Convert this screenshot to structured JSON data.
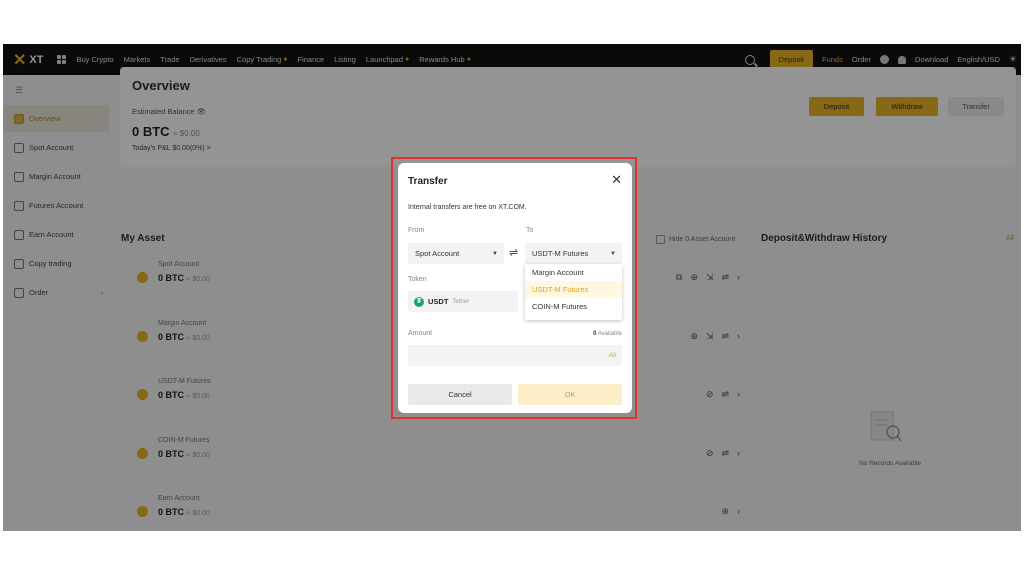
{
  "topbar": {
    "logo": "XT",
    "nav": [
      {
        "label": "Buy Crypto",
        "fire": false
      },
      {
        "label": "Markets",
        "fire": false
      },
      {
        "label": "Trade",
        "fire": false
      },
      {
        "label": "Derivatives",
        "fire": false
      },
      {
        "label": "Copy Trading",
        "fire": true
      },
      {
        "label": "Finance",
        "fire": false
      },
      {
        "label": "Listing",
        "fire": false
      },
      {
        "label": "Launchpad",
        "fire": true
      },
      {
        "label": "Rewards Hub",
        "fire": true
      }
    ],
    "deposit": "Deposit",
    "funds": "Funds",
    "order": "Order",
    "download": "Download",
    "language": "English/USD"
  },
  "sidebar": {
    "items": [
      {
        "label": "Overview",
        "active": true
      },
      {
        "label": "Spot Account",
        "active": false
      },
      {
        "label": "Margin Account",
        "active": false
      },
      {
        "label": "Futures Account",
        "active": false
      },
      {
        "label": "Earn Account",
        "active": false
      },
      {
        "label": "Copy trading",
        "active": false
      },
      {
        "label": "Order",
        "active": false
      }
    ]
  },
  "overview": {
    "title": "Overview",
    "estimated": "Estimated Balance",
    "balance": "0 BTC",
    "balance_usd": "≈ $0.00",
    "pnl": "Today's P&L  $0.00(0%) >",
    "deposit": "Deposit",
    "withdraw": "Withdraw",
    "transfer": "Transfer"
  },
  "my_asset": {
    "title": "My Asset",
    "hide_zero": "Hide 0 Asset Account",
    "rows": [
      {
        "name": "Spot Account",
        "balance": "0 BTC",
        "usd": "≈ $0.00"
      },
      {
        "name": "Margin Account",
        "balance": "0 BTC",
        "usd": "≈ $0.00"
      },
      {
        "name": "USDT-M Futures",
        "balance": "0 BTC",
        "usd": "≈ $0.00"
      },
      {
        "name": "COIN-M Futures",
        "balance": "0 BTC",
        "usd": "≈ $0.00"
      },
      {
        "name": "Earn Account",
        "balance": "0 BTC",
        "usd": "≈ $0.00"
      }
    ]
  },
  "history": {
    "title": "Deposit&Withdraw History",
    "all": "All",
    "empty": "No Records Available"
  },
  "modal": {
    "title": "Transfer",
    "note": "Internal transfers are free on XT.COM.",
    "from_label": "From",
    "to_label": "To",
    "from_value": "Spot Account",
    "to_value": "USDT-M Futures",
    "token_label": "Token",
    "token": "USDT",
    "token_sub": "Tether",
    "options": [
      "Margin Account",
      "USDT-M Futures",
      "COIN-M Futures"
    ],
    "selected_option": "USDT-M Futures",
    "amount_label": "Amount",
    "available_value": "0",
    "available_label": "Available",
    "all": "All",
    "cancel": "Cancel",
    "ok": "OK"
  },
  "colors": {
    "accent": "#e8b428",
    "highlight_border": "#e33030",
    "topbar_bg": "#121212"
  }
}
